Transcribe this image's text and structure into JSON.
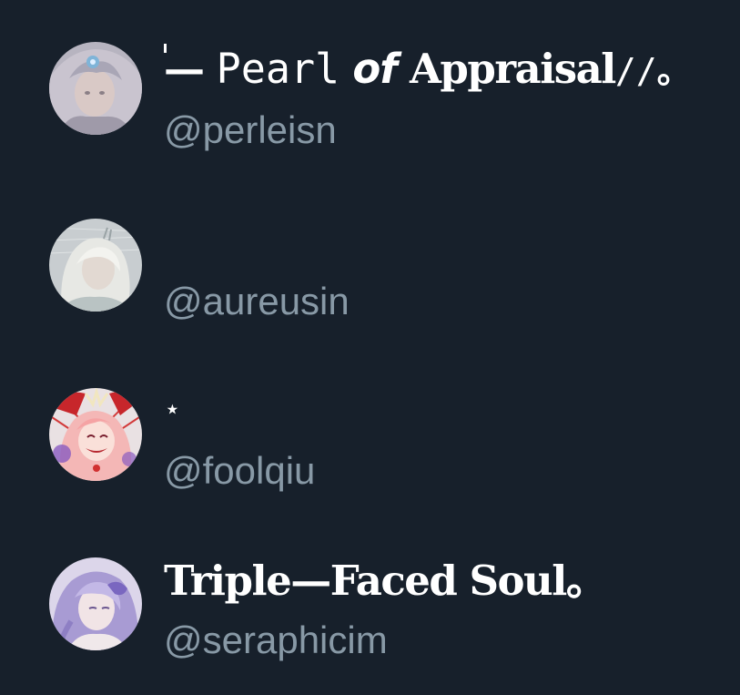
{
  "accounts": [
    {
      "name_parts": [
        "—",
        "Pearl",
        "of",
        "Appraisal",
        "//",
        "。"
      ],
      "handle": "@perleisn",
      "avatar_icon": "avatar-silver-hair-crystal"
    },
    {
      "name": "",
      "handle": "@aureusin",
      "avatar_icon": "avatar-white-hair-sketch"
    },
    {
      "name": "⋆",
      "handle": "@foolqiu",
      "avatar_icon": "avatar-pink-hair-red"
    },
    {
      "name": "Triple—Faced Soul。",
      "handle": "@seraphicim",
      "avatar_icon": "avatar-lavender-hair"
    }
  ],
  "colors": {
    "background": "#17202b",
    "name_text": "#ffffff",
    "handle_text": "#8899a6"
  }
}
